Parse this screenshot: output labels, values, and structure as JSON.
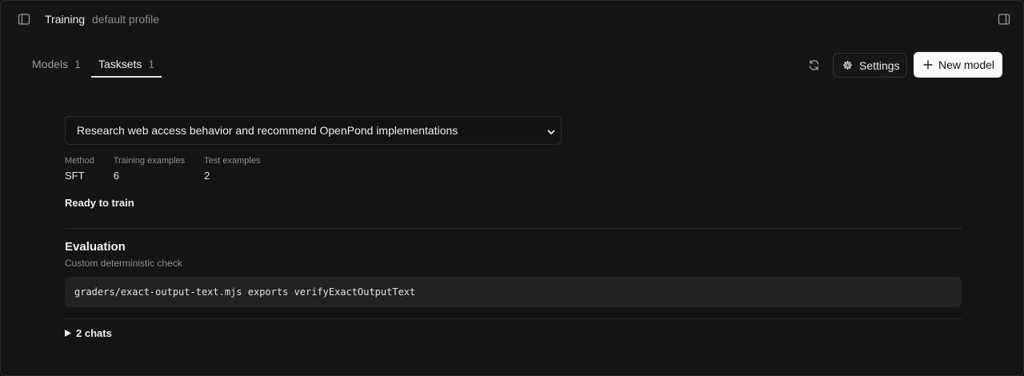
{
  "header": {
    "title": "Training",
    "subtitle": "default profile",
    "left_icon": "sidebar-toggle-icon",
    "right_icon": "panel-toggle-icon"
  },
  "tabs": [
    {
      "label": "Models",
      "count": "1",
      "active": false
    },
    {
      "label": "Tasksets",
      "count": "1",
      "active": true
    }
  ],
  "actions": {
    "refresh_icon": "refresh-icon",
    "settings_label": "Settings",
    "new_model_label": "New model"
  },
  "taskset": {
    "selected": "Research web access behavior and recommend OpenPond implementations",
    "stats": [
      {
        "label": "Method",
        "value": "SFT"
      },
      {
        "label": "Training examples",
        "value": "6"
      },
      {
        "label": "Test examples",
        "value": "2"
      }
    ],
    "status": "Ready to train"
  },
  "evaluation": {
    "title": "Evaluation",
    "subtitle": "Custom deterministic check",
    "code": "graders/exact-output-text.mjs exports verifyExactOutputText"
  },
  "chats": {
    "label": "2 chats"
  },
  "colors": {
    "background": "#151515",
    "primary_button": "#fafafa",
    "text": "#e8e8e8",
    "muted": "#8f8f8f"
  }
}
